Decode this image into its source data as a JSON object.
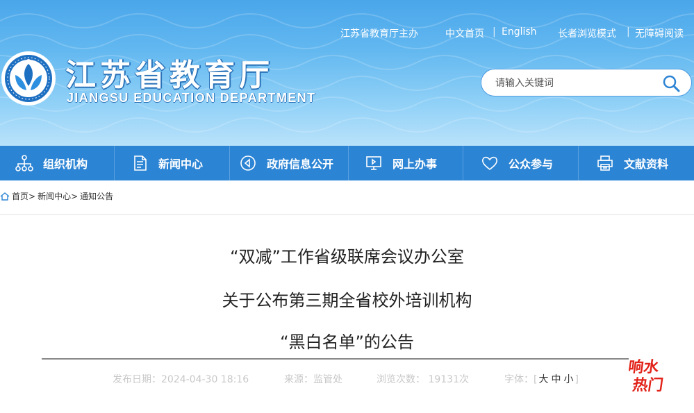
{
  "top_links": {
    "host": "江苏省教育厅主办",
    "home_cn": "中文首页",
    "english": "English",
    "elder_mode": "长者浏览模式",
    "accessible": "无障碍阅读"
  },
  "brand": {
    "title_cn": "江苏省教育厅",
    "title_en": "JIANGSU EDUCATION DEPARTMENT"
  },
  "search": {
    "placeholder": "请输入关键词"
  },
  "nav": [
    {
      "label": "组织机构",
      "icon": "org-chart-icon"
    },
    {
      "label": "新闻中心",
      "icon": "document-icon"
    },
    {
      "label": "政府信息公开",
      "icon": "play-circle-icon"
    },
    {
      "label": "网上办事",
      "icon": "monitor-icon"
    },
    {
      "label": "公众参与",
      "icon": "heart-icon"
    },
    {
      "label": "文献资料",
      "icon": "printer-icon"
    }
  ],
  "breadcrumb": {
    "home": "首页>",
    "section": "新闻中心>",
    "current": "通知公告"
  },
  "article": {
    "title_line1": "“双减”工作省级联席会议办公室",
    "title_line2": "关于公布第三期全省校外培训机构",
    "title_line3": "“黑白名单”的公告",
    "publish_label": "发布日期：2024-04-30 18:16",
    "source_label": "来源：监管处",
    "views_label": "浏览次数： 19131次",
    "font_label": "字体：",
    "font_large": "大",
    "font_medium": "中",
    "font_small": "小"
  },
  "hot_badge": {
    "line1": "响水",
    "line2": "热门"
  },
  "colors": {
    "nav_bg": "#2c84d4",
    "header_top": "#4aa6ea",
    "header_bottom": "#b9e2fa",
    "hot_red": "#e2231a"
  }
}
